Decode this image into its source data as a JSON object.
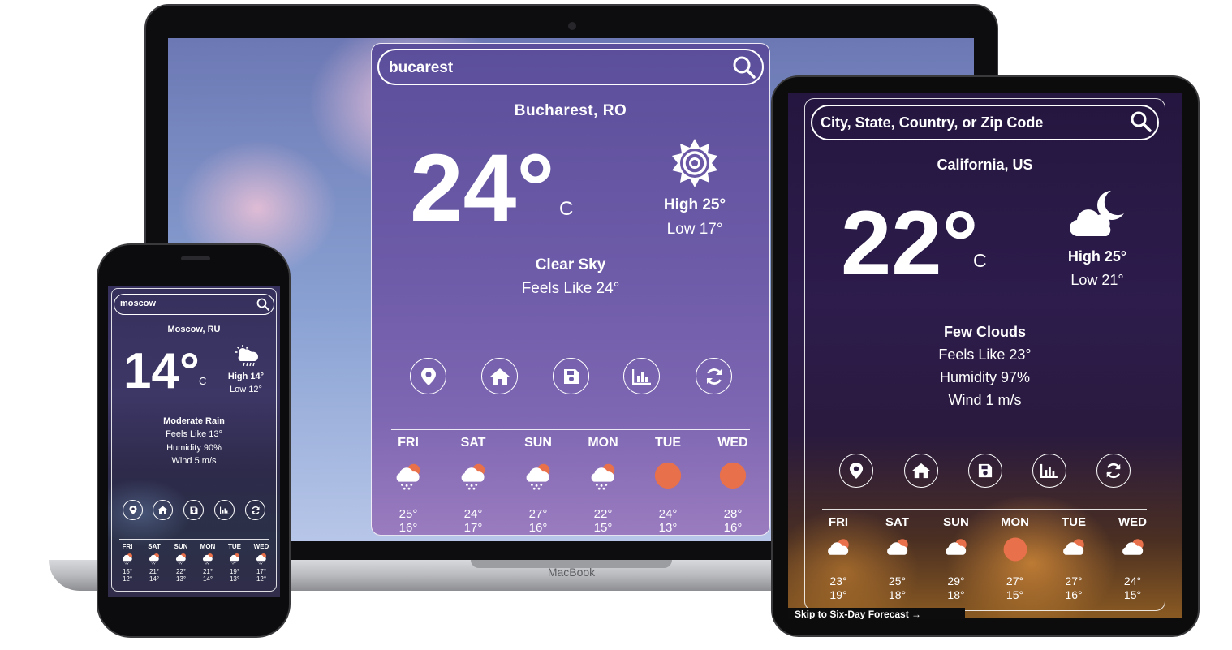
{
  "macbook": {
    "brand_label": "MacBook",
    "search": {
      "value": "bucarest"
    },
    "location": "Bucharest, RO",
    "temp": "24°",
    "unit": "C",
    "high": "High 25°",
    "low": "Low 17°",
    "condition": "Clear Sky",
    "feels_like": "Feels Like 24°",
    "weather_icon": "gear-sun-icon",
    "actions": [
      "location-icon",
      "home-icon",
      "save-icon",
      "chart-icon",
      "refresh-icon"
    ],
    "forecast": [
      {
        "day": "FRI",
        "high": "25°",
        "low": "16°",
        "icon": "cloud-rain-sun-icon"
      },
      {
        "day": "SAT",
        "high": "24°",
        "low": "17°",
        "icon": "cloud-rain-sun-icon"
      },
      {
        "day": "SUN",
        "high": "27°",
        "low": "16°",
        "icon": "cloud-rain-sun-icon"
      },
      {
        "day": "MON",
        "high": "22°",
        "low": "15°",
        "icon": "cloud-rain-sun-icon"
      },
      {
        "day": "TUE",
        "high": "24°",
        "low": "13°",
        "icon": "sun-icon"
      },
      {
        "day": "WED",
        "high": "28°",
        "low": "16°",
        "icon": "sun-icon"
      }
    ]
  },
  "ipad": {
    "search": {
      "placeholder": "City, State, Country, or Zip Code"
    },
    "location": "California, US",
    "temp": "22°",
    "unit": "C",
    "high": "High 25°",
    "low": "Low 21°",
    "condition": "Few Clouds",
    "feels_like": "Feels Like 23°",
    "humidity": "Humidity 97%",
    "wind": "Wind 1 m/s",
    "weather_icon": "moon-cloud-icon",
    "skip_link": "Skip to Six-Day Forecast →",
    "forecast": [
      {
        "day": "FRI",
        "high": "23°",
        "low": "19°",
        "icon": "cloud-sun-icon"
      },
      {
        "day": "SAT",
        "high": "25°",
        "low": "18°",
        "icon": "cloud-sun-icon"
      },
      {
        "day": "SUN",
        "high": "29°",
        "low": "18°",
        "icon": "cloud-sun-icon"
      },
      {
        "day": "MON",
        "high": "27°",
        "low": "15°",
        "icon": "sun-icon"
      },
      {
        "day": "TUE",
        "high": "27°",
        "low": "16°",
        "icon": "cloud-sun-icon"
      },
      {
        "day": "WED",
        "high": "24°",
        "low": "15°",
        "icon": "cloud-sun-icon"
      }
    ]
  },
  "iphone": {
    "search": {
      "value": "moscow"
    },
    "location": "Moscow, RU",
    "temp": "14°",
    "unit": "C",
    "high": "High 14°",
    "low": "Low 12°",
    "condition": "Moderate Rain",
    "feels_like": "Feels Like 13°",
    "humidity": "Humidity 90%",
    "wind": "Wind 5 m/s",
    "weather_icon": "sun-cloud-rain-icon",
    "forecast": [
      {
        "day": "FRI",
        "high": "15°",
        "low": "12°"
      },
      {
        "day": "SAT",
        "high": "21°",
        "low": "14°"
      },
      {
        "day": "SUN",
        "high": "22°",
        "low": "13°"
      },
      {
        "day": "MON",
        "high": "21°",
        "low": "14°"
      },
      {
        "day": "TUE",
        "high": "19°",
        "low": "13°"
      },
      {
        "day": "WED",
        "high": "17°",
        "low": "12°"
      }
    ]
  },
  "colors": {
    "sun": "#e8704a",
    "panel_border": "#ffffff"
  }
}
